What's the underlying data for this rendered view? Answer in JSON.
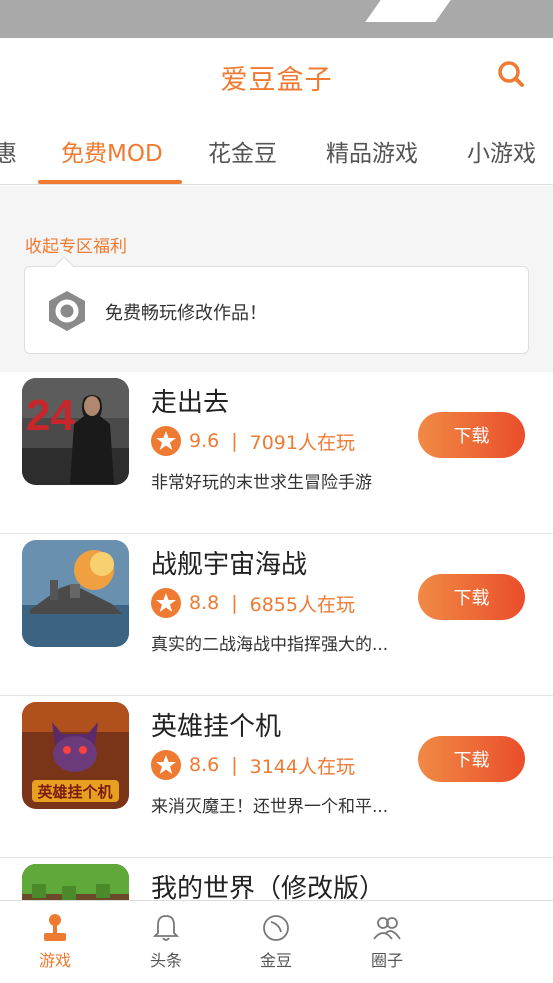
{
  "header": {
    "title": "爱豆盒子"
  },
  "tabs": [
    "惠",
    "免费MOD",
    "花金豆",
    "精品游戏",
    "小游戏"
  ],
  "welfare": {
    "collapse_label": "收起专区福利",
    "text": "免费畅玩修改作品！"
  },
  "games": [
    {
      "name": "走出去",
      "score": "9.6",
      "players": "7091人在玩",
      "desc": "非常好玩的末世求生冒险手游",
      "button": "下载"
    },
    {
      "name": "战舰宇宙海战",
      "score": "8.8",
      "players": "6855人在玩",
      "desc": "真实的二战海战中指挥强大的...",
      "button": "下载"
    },
    {
      "name": "英雄挂个机",
      "score": "8.6",
      "players": "3144人在玩",
      "desc": "来消灭魔王！还世界一个和平...",
      "button": "下载",
      "icon_text": "英雄挂个机"
    },
    {
      "name": "我的世界（修改版）",
      "score": "",
      "players": "",
      "desc": "",
      "button": ""
    }
  ],
  "sep": "|",
  "nav": [
    "游戏",
    "头条",
    "金豆",
    "圈子"
  ],
  "colors": {
    "accent": "#ef7a32",
    "button_start": "#f08a45",
    "button_end": "#ea4e2b"
  },
  "icons": {
    "search": "search-icon",
    "welfare": "hexagon-icon",
    "rating": "star-badge-icon",
    "nav": [
      "joystick-icon",
      "bell-icon",
      "coin-icon",
      "people-icon"
    ]
  }
}
